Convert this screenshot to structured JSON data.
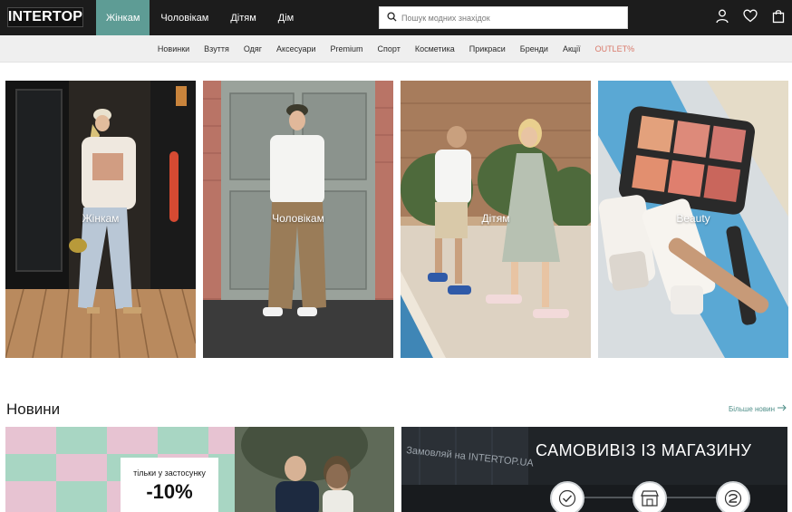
{
  "header": {
    "logo": "INTERTOP",
    "tabs": [
      {
        "label": "Жінкам",
        "active": true
      },
      {
        "label": "Чоловікам",
        "active": false
      },
      {
        "label": "Дітям",
        "active": false
      },
      {
        "label": "Дім",
        "active": false
      }
    ],
    "search": {
      "placeholder": "Пошук модних знахідок",
      "value": ""
    },
    "icons": [
      "user-icon",
      "heart-icon",
      "bag-icon"
    ]
  },
  "categories": [
    "Новинки",
    "Взуття",
    "Одяг",
    "Аксесуари",
    "Premium",
    "Спорт",
    "Косметика",
    "Прикраси",
    "Бренди",
    "Акції",
    "OUTLET%"
  ],
  "hero_cards": [
    {
      "label": "Жінкам"
    },
    {
      "label": "Чоловікам"
    },
    {
      "label": "Дітям"
    },
    {
      "label": "Beauty"
    }
  ],
  "news": {
    "title": "Новини",
    "more_link": "Більше новин",
    "banner_promo": {
      "small": "тільки у застосунку",
      "big": "-10%"
    },
    "banner_pickup": {
      "title": "САМОВИВІЗ ІЗ МАГАЗИНУ",
      "sign": "Замовляй на INTERTOP.UA"
    }
  },
  "colors": {
    "topbar": "#1c1c1c",
    "active_tab": "#5e9c95",
    "outlet": "#d9796a",
    "link": "#4f8f89"
  }
}
